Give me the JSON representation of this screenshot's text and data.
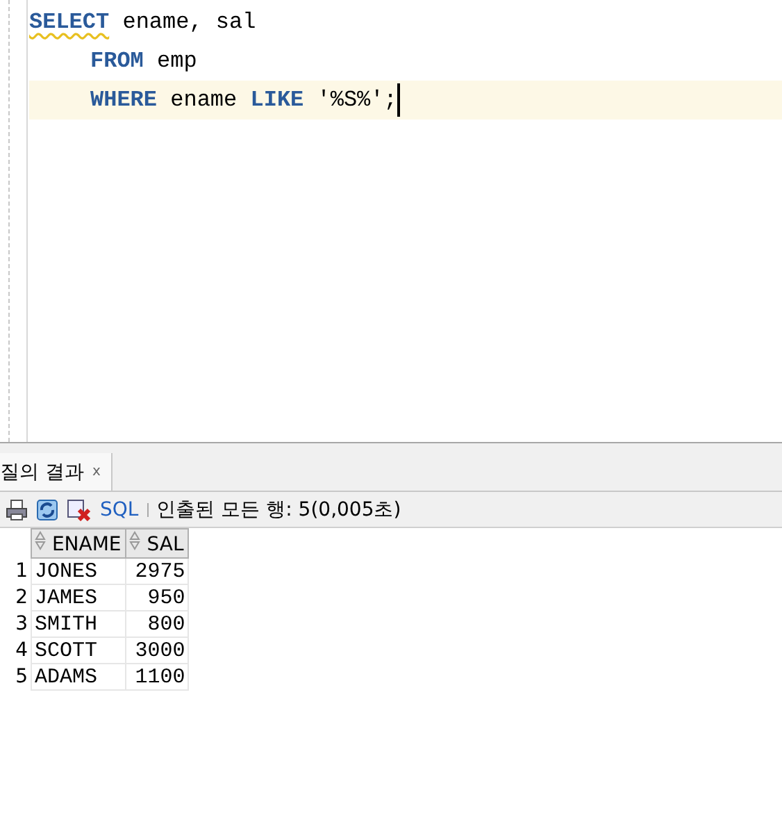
{
  "editor": {
    "lines": [
      {
        "indented": false,
        "current": false,
        "tokens": [
          {
            "kind": "keyword",
            "text": "SELECT",
            "warning": true
          },
          {
            "kind": "plain",
            "text": " ename, sal",
            "warning": false
          }
        ]
      },
      {
        "indented": true,
        "current": false,
        "tokens": [
          {
            "kind": "keyword",
            "text": "FROM",
            "warning": false
          },
          {
            "kind": "plain",
            "text": " emp",
            "warning": false
          }
        ]
      },
      {
        "indented": true,
        "current": true,
        "tokens": [
          {
            "kind": "keyword",
            "text": "WHERE",
            "warning": false
          },
          {
            "kind": "plain",
            "text": " ename ",
            "warning": false
          },
          {
            "kind": "keyword",
            "text": "LIKE",
            "warning": false
          },
          {
            "kind": "plain",
            "text": " '%S%';",
            "warning": false
          }
        ]
      }
    ]
  },
  "results": {
    "tab": {
      "label": "질의 결과",
      "close": "x",
      "selected": true
    },
    "toolbar": {
      "sql_link": "SQL",
      "status": "인출된 모든 행: 5(0,005초)"
    },
    "columns": [
      "ENAME",
      "SAL"
    ],
    "rows": [
      {
        "number": "1",
        "cells": [
          "JONES",
          "2975"
        ]
      },
      {
        "number": "2",
        "cells": [
          "JAMES",
          "950"
        ]
      },
      {
        "number": "3",
        "cells": [
          "SMITH",
          "800"
        ]
      },
      {
        "number": "4",
        "cells": [
          "SCOTT",
          "3000"
        ]
      },
      {
        "number": "5",
        "cells": [
          "ADAMS",
          "1100"
        ]
      }
    ]
  }
}
